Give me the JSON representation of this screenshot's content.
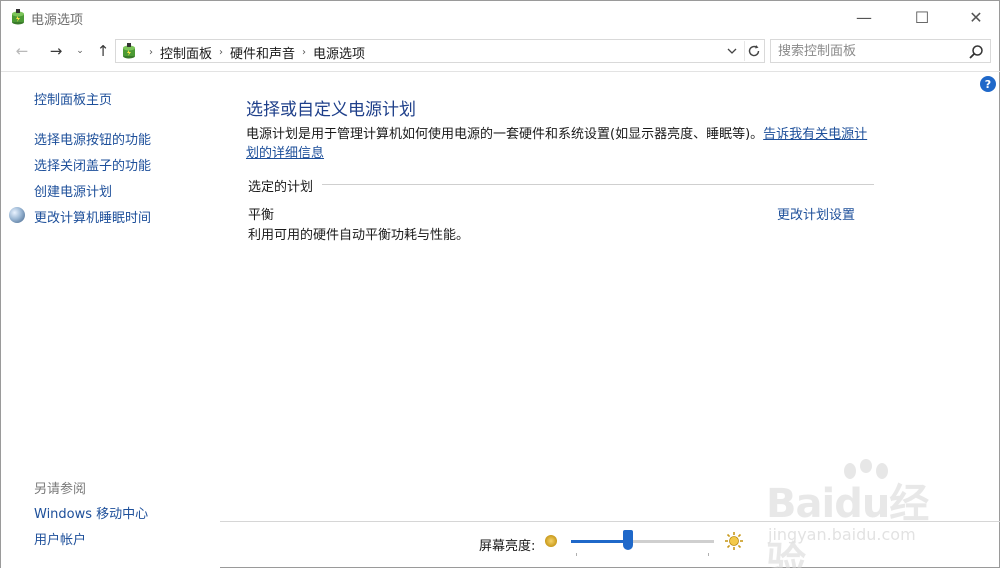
{
  "window": {
    "title": "电源选项",
    "minimize": "—",
    "maximize": "☐",
    "close": "✕"
  },
  "nav": {
    "back": "←",
    "forward": "→",
    "recent": "⌄",
    "up": "↑"
  },
  "address": {
    "crumbs": [
      "控制面板",
      "硬件和声音",
      "电源选项"
    ],
    "separator": "›"
  },
  "search": {
    "placeholder": "搜索控制面板"
  },
  "sidebar": {
    "home": "控制面板主页",
    "items": [
      {
        "label": "选择电源按钮的功能"
      },
      {
        "label": "选择关闭盖子的功能"
      },
      {
        "label": "创建电源计划"
      },
      {
        "label": "更改计算机睡眠时间"
      }
    ],
    "see_also_heading": "另请参阅",
    "see_also": [
      {
        "label": "Windows 移动中心"
      },
      {
        "label": "用户帐户"
      }
    ]
  },
  "main": {
    "title": "选择或自定义电源计划",
    "description": "电源计划是用于管理计算机如何使用电源的一套硬件和系统设置(如显示器亮度、睡眠等)。",
    "description_link": "告诉我有关电源计划的详细信息",
    "group_header": "选定的计划",
    "plan": {
      "name": "平衡",
      "description": "利用可用的硬件自动平衡功耗与性能。",
      "settings_link": "更改计划设置"
    }
  },
  "footer": {
    "brightness_label": "屏幕亮度:",
    "brightness_level": 0.4
  },
  "help": "?",
  "watermark": {
    "brand": "Baidu经验",
    "url": "jingyan.baidu.com"
  },
  "colors": {
    "link": "#1d4f9a",
    "title": "#1e3f8a",
    "accent": "#1f68c9"
  }
}
